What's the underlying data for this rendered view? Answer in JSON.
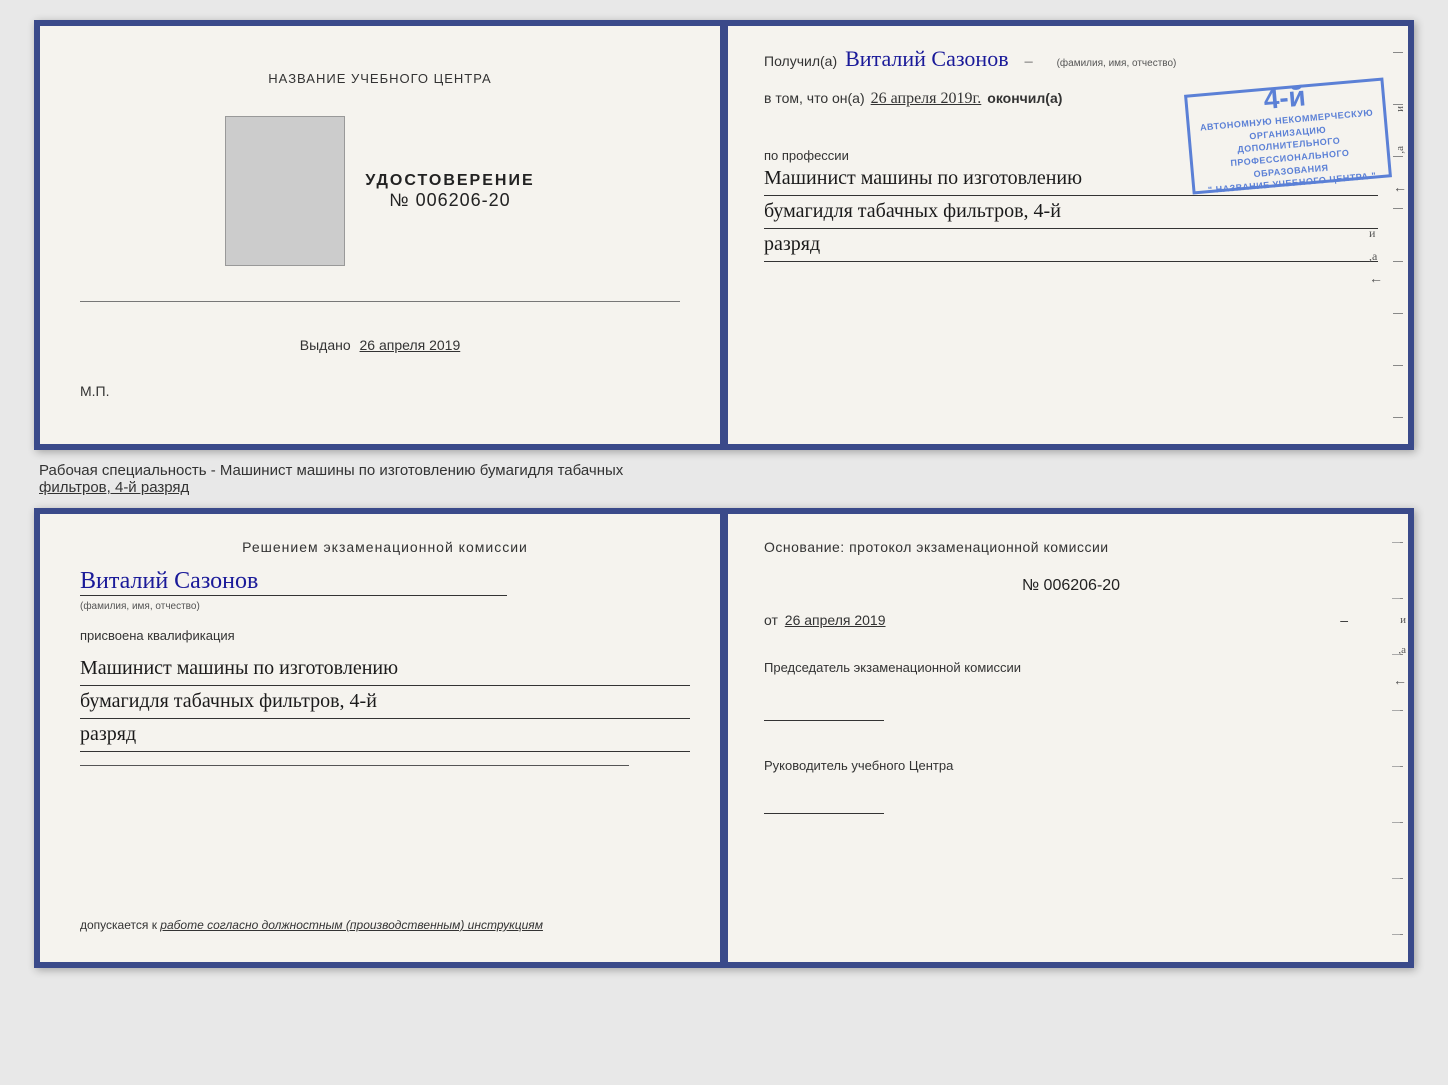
{
  "top_cert": {
    "left": {
      "center_title": "НАЗВАНИЕ УЧЕБНОГО ЦЕНТРА",
      "udost_title": "УДОСТОВЕРЕНИЕ",
      "udost_number": "№ 006206-20",
      "vydano_label": "Выдано",
      "vydano_date": "26 апреля 2019",
      "mp": "М.П."
    },
    "right": {
      "poluchil_prefix": "Получил(а)",
      "name": "Виталий Сазонов",
      "name_caption": "(фамилия, имя, отчество)",
      "vtom_prefix": "в том, что он(а)",
      "vtom_date": "26 апреля 2019г.",
      "okonchil": "окончил(а)",
      "stamp_large": "4-й",
      "stamp_line1": "АВТОНОМНУЮ НЕКОММЕРЧЕСКУЮ ОРГАНИЗАЦИЮ",
      "stamp_line2": "ДОПОЛНИТЕЛЬНОГО ПРОФЕССИОНАЛЬНОГО ОБРАЗОВАНИЯ",
      "stamp_line3": "\" НАЗВАНИЕ УЧЕБНОГО ЦЕНТРА \"",
      "i_label": "и",
      "a_label": ",а",
      "arrow_label": "←",
      "po_professii": "по профессии",
      "profession_line1": "Машинист машины по изготовлению",
      "profession_line2": "бумагидля табачных фильтров, 4-й",
      "profession_line3": "разряд"
    }
  },
  "specialty_label": {
    "prefix": "Рабочая специальность - Машинист машины по изготовлению бумагидля табачных",
    "underlined": "фильтров, 4-й разряд"
  },
  "bottom_cert": {
    "left": {
      "resheniem": "Решением экзаменационной комиссии",
      "name": "Виталий Сазонов",
      "name_caption": "(фамилия, имя, отчество)",
      "prisvoena": "присвоена квалификация",
      "qual_line1": "Машинист машины по изготовлению",
      "qual_line2": "бумагидля табачных фильтров, 4-й",
      "qual_line3": "разряд",
      "dopuskaetsya": "допускается к",
      "dopusk_val": "работе согласно должностным (производственным) инструкциям"
    },
    "right": {
      "osnovanie": "Основание: протокол экзаменационной комиссии",
      "number": "№  006206-20",
      "ot_label": "от",
      "ot_date": "26 апреля 2019",
      "predsedatel_title": "Председатель экзаменационной комиссии",
      "rukovoditel_title": "Руководитель учебного Центра",
      "i_label": "и",
      "a_label": ",а",
      "arrow_label": "←"
    }
  }
}
